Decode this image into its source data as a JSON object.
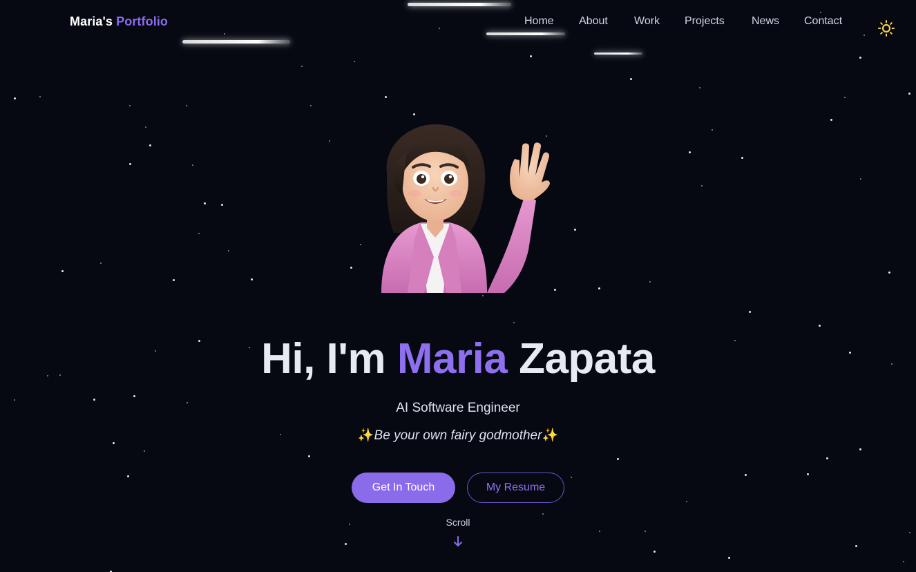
{
  "header": {
    "logo_name": "Maria's",
    "logo_accent": "Portfolio"
  },
  "nav": {
    "items": [
      "Home",
      "About",
      "Work",
      "Projects",
      "News",
      "Contact"
    ]
  },
  "theme_toggle_icon": "sun-icon",
  "hero": {
    "greeting": "Hi, I'm",
    "first_name": "Maria",
    "last_name": "Zapata",
    "role": "AI Software Engineer",
    "tagline_spark": "✨",
    "tagline": "Be your own fairy godmother",
    "primary_cta": "Get In Touch",
    "secondary_cta": "My Resume",
    "scroll_label": "Scroll",
    "scroll_icon": "arrow-down-icon"
  },
  "colors": {
    "background": "#060912",
    "accent": "#8b6cf0",
    "text": "#e8eaf3",
    "sun": "#f3cf4b"
  }
}
